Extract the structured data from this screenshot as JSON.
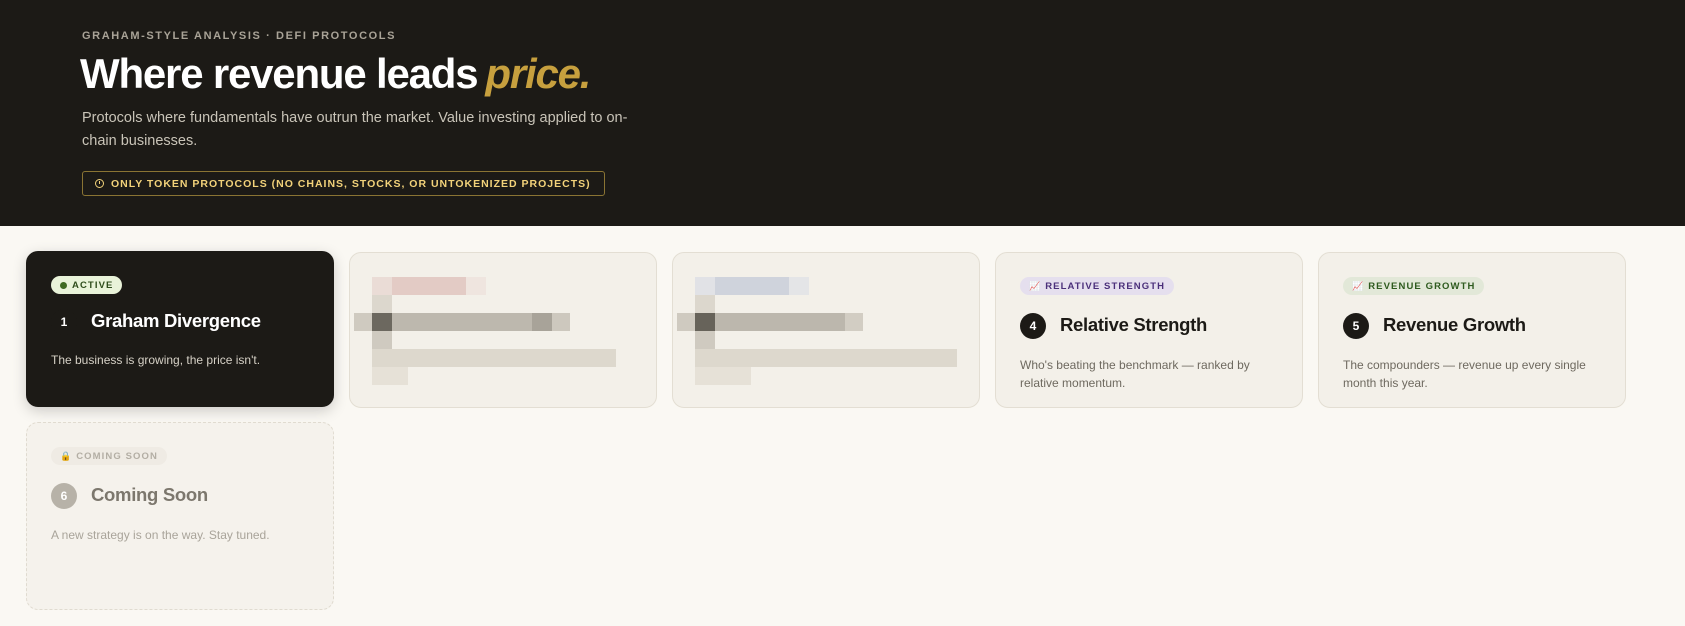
{
  "hero": {
    "eyebrow": "GRAHAM-STYLE ANALYSIS · DEFI PROTOCOLS",
    "headline_main": "Where revenue leads",
    "headline_accent": "price.",
    "subhead": "Protocols where fundamentals have outrun the market. Value investing applied to on-chain businesses.",
    "notice": "ONLY TOKEN PROTOCOLS (NO CHAINS, STOCKS, OR UNTOKENIZED PROJECTS)",
    "notice_icon": "info-circle-icon"
  },
  "strategies": [
    {
      "badge": "ACTIVE",
      "number": "1",
      "title": "Graham Divergence",
      "description": "The business is growing, the price isn't.",
      "state": "active"
    },
    {
      "state": "pixelated",
      "tint": "red"
    },
    {
      "state": "pixelated",
      "tint": "blue"
    },
    {
      "badge": "RELATIVE STRENGTH",
      "badge_icon": "chart-up-icon",
      "number": "4",
      "title": "Relative Strength",
      "description": "Who's beating the benchmark — ranked by relative momentum.",
      "state": "available",
      "accent": "#4a2f7a"
    },
    {
      "badge": "REVENUE GROWTH",
      "badge_icon": "chart-up-icon",
      "number": "5",
      "title": "Revenue Growth",
      "description": "The compounders — revenue up every single month this year.",
      "state": "available",
      "accent": "#2d5a1e"
    },
    {
      "badge": "COMING SOON",
      "badge_icon": "lock-icon",
      "number": "6",
      "title": "Coming Soon",
      "description": "A new strategy is on the way. Stay tuned.",
      "state": "coming-soon"
    }
  ],
  "colors": {
    "hero_bg": "#1c1a16",
    "accent_gold": "#c7a03e",
    "page_bg": "#faf8f3"
  }
}
